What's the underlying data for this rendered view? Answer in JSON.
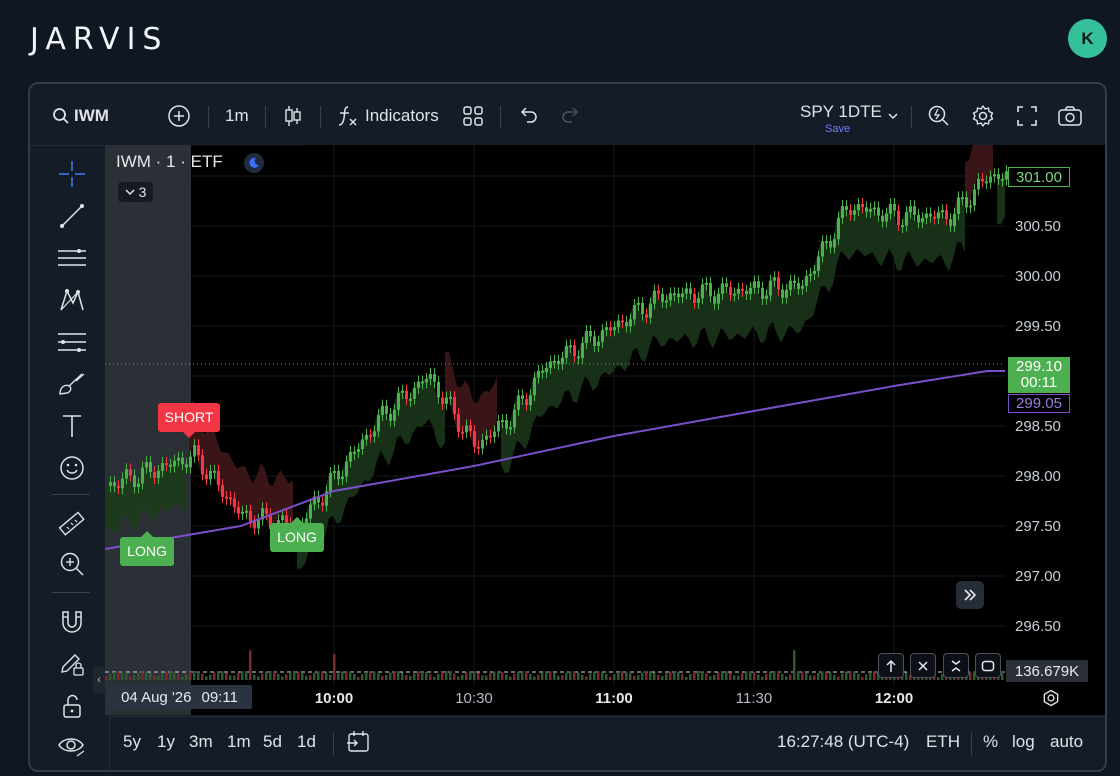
{
  "app": {
    "logo": "JARVIS",
    "avatar_initial": "K",
    "avatar_color": "#34c19a"
  },
  "toolbar": {
    "symbol": "IWM",
    "interval": "1m",
    "indicators_label": "Indicators",
    "layout_name": "SPY 1DTE",
    "layout_sub": "Save"
  },
  "chart": {
    "symbol_line": "IWM · 1 · ETF",
    "collapsed_count": "3",
    "price_axis": [
      "301.00",
      "300.50",
      "300.00",
      "299.50",
      "299.00",
      "298.50",
      "298.00",
      "297.50",
      "297.00",
      "296.50"
    ],
    "highlighted_prices": {
      "top": "301.00",
      "current": "299.10",
      "countdown": "00:11",
      "vwap": "299.05",
      "volume": "136.679K"
    },
    "time_axis": [
      "10:00",
      "10:30",
      "11:00",
      "11:30",
      "12:00"
    ],
    "cursor_date": "04 Aug '26",
    "cursor_time": "09:11",
    "signals": [
      {
        "label": "SHORT",
        "color": "#f23645"
      },
      {
        "label": "LONG",
        "color": "#4caf50"
      },
      {
        "label": "LONG",
        "color": "#4caf50"
      }
    ],
    "colors": {
      "up": "#4caf50",
      "down": "#f23645",
      "vwap": "#7b4fc8"
    }
  },
  "bottombar": {
    "ranges": [
      "5y",
      "1y",
      "3m",
      "1m",
      "5d",
      "1d"
    ],
    "clock": "16:27:48 (UTC-4)",
    "session": "ETH",
    "percent": "%",
    "log": "log",
    "auto": "auto"
  },
  "chart_data": {
    "type": "candlestick",
    "title": "IWM · 1 · ETF",
    "ylim": [
      296.3,
      301.2
    ],
    "x_ticks": [
      "10:00",
      "10:30",
      "11:00",
      "11:30",
      "12:00"
    ],
    "key_points": [
      {
        "time": "09:11",
        "price": 297.9
      },
      {
        "time": "09:30",
        "price": 298.2
      },
      {
        "time": "09:40",
        "price": 297.6
      },
      {
        "time": "09:52",
        "price": 297.5
      },
      {
        "time": "10:10",
        "price": 298.6
      },
      {
        "time": "10:20",
        "price": 299.0
      },
      {
        "time": "10:30",
        "price": 298.3
      },
      {
        "time": "10:38",
        "price": 298.6
      },
      {
        "time": "10:45",
        "price": 299.1
      },
      {
        "time": "11:00",
        "price": 299.5
      },
      {
        "time": "11:10",
        "price": 299.8
      },
      {
        "time": "11:25",
        "price": 299.85
      },
      {
        "time": "11:40",
        "price": 299.9
      },
      {
        "time": "11:50",
        "price": 300.7
      },
      {
        "time": "12:00",
        "price": 300.6
      },
      {
        "time": "12:12",
        "price": 300.6
      },
      {
        "time": "12:20",
        "price": 301.0
      }
    ],
    "vwap": [
      {
        "time": "09:11",
        "price": 297.27
      },
      {
        "time": "09:40",
        "price": 297.5
      },
      {
        "time": "10:00",
        "price": 297.85
      },
      {
        "time": "10:30",
        "price": 298.1
      },
      {
        "time": "11:00",
        "price": 298.4
      },
      {
        "time": "11:30",
        "price": 298.65
      },
      {
        "time": "12:00",
        "price": 298.9
      },
      {
        "time": "12:20",
        "price": 299.05
      }
    ]
  }
}
